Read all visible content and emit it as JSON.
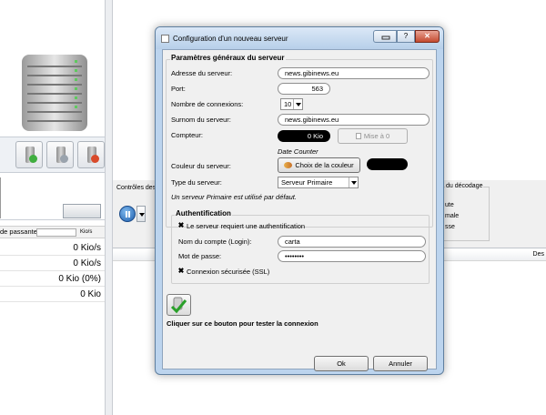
{
  "background": {
    "speed_label": "de passante :",
    "speed_unit": "Kio/s",
    "stats": [
      "0 Kio/s",
      "0 Kio/s",
      "0 Kio (0%)",
      "0 Kio"
    ],
    "controls_title": "Contrôles des",
    "decode_title": "du décodage",
    "decode_items": [
      "ute",
      "male",
      "sse"
    ],
    "list_header": "Des"
  },
  "dialog": {
    "title": "Configuration d'un nouveau serveur",
    "window_buttons": {
      "help": "?",
      "close": "✕"
    },
    "general": {
      "title": "Paramètres généraux du serveur",
      "address_label": "Adresse du serveur:",
      "address_value": "news.gibinews.eu",
      "port_label": "Port:",
      "port_value": "563",
      "connections_label": "Nombre de connexions:",
      "connections_value": "10",
      "nickname_label": "Surnom du serveur:",
      "nickname_value": "news.gibinews.eu",
      "counter_label": "Compteur:",
      "counter_value": "0 Kio",
      "reset_button": "Mise à 0",
      "date_counter": "Date Counter",
      "color_label": "Couleur du serveur:",
      "color_button": "Choix de la couleur",
      "server_color": "#000000",
      "type_label": "Type du serveur:",
      "type_value": "Serveur Primaire",
      "type_note": "Un serveur Primaire est utilisé par défaut."
    },
    "auth": {
      "title": "Authentification",
      "requires_auth_label": "Le serveur requiert une authentification",
      "requires_auth_checked": true,
      "login_label": "Nom du compte (Login):",
      "login_value": "carta",
      "password_label": "Mot de passe:",
      "password_value": "••••••••",
      "ssl_label": "Connexion sécurisée (SSL)",
      "ssl_checked": true
    },
    "test_label": "Cliquer sur ce bouton pour tester la connexion",
    "ok_button": "Ok",
    "cancel_button": "Annuler"
  }
}
